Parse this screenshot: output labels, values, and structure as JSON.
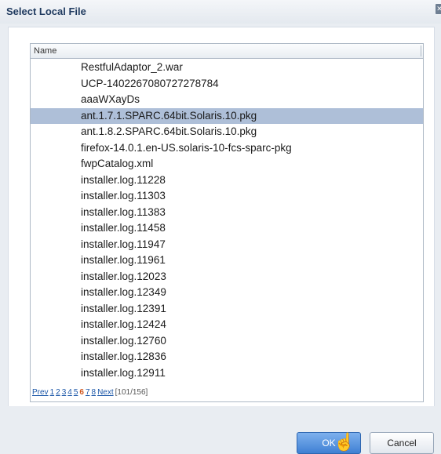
{
  "dialog": {
    "title": "Select Local File"
  },
  "table": {
    "header": "Name",
    "files": [
      "RestfulAdaptor_2.war",
      "UCP-1402267080727278784",
      "aaaWXayDs",
      "ant.1.7.1.SPARC.64bit.Solaris.10.pkg",
      "ant.1.8.2.SPARC.64bit.Solaris.10.pkg",
      "firefox-14.0.1.en-US.solaris-10-fcs-sparc-pkg",
      "fwpCatalog.xml",
      "installer.log.11228",
      "installer.log.11303",
      "installer.log.11383",
      "installer.log.11458",
      "installer.log.11947",
      "installer.log.11961",
      "installer.log.12023",
      "installer.log.12349",
      "installer.log.12391",
      "installer.log.12424",
      "installer.log.12760",
      "installer.log.12836",
      "installer.log.12911"
    ],
    "selected_index": 3
  },
  "pagination": {
    "prev": "Prev",
    "pages": [
      "1",
      "2",
      "3",
      "4",
      "5",
      "6",
      "7",
      "8"
    ],
    "current": "6",
    "next": "Next",
    "count": "[101/156]"
  },
  "buttons": {
    "ok": "OK",
    "cancel": "Cancel"
  }
}
